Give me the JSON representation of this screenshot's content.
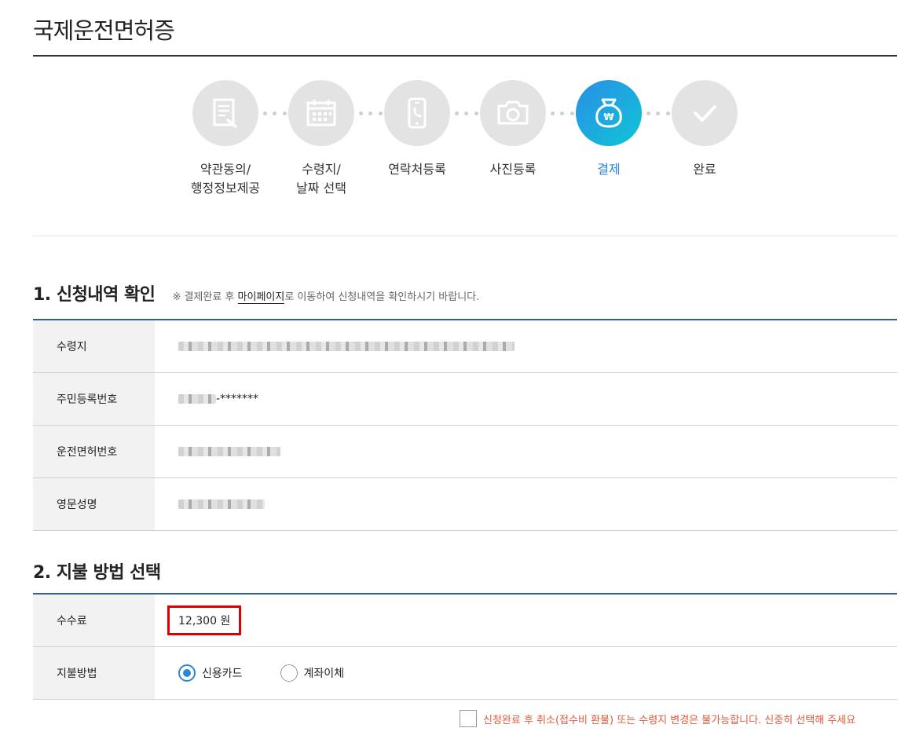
{
  "page": {
    "title": "국제운전면허증"
  },
  "steps": [
    {
      "label": "약관동의/\n행정정보제공",
      "icon": "document-edit-icon",
      "active": false
    },
    {
      "label": "수령지/\n날짜 선택",
      "icon": "calendar-icon",
      "active": false
    },
    {
      "label": "연락처등록",
      "icon": "phone-icon",
      "active": false
    },
    {
      "label": "사진등록",
      "icon": "camera-icon",
      "active": false
    },
    {
      "label": "결제",
      "icon": "money-bag-won-icon",
      "active": true
    },
    {
      "label": "완료",
      "icon": "check-icon",
      "active": false
    }
  ],
  "section1": {
    "title": "1. 신청내역 확인",
    "note_prefix": "※ 결제완료 후 ",
    "note_link": "마이페이지",
    "note_suffix": "로 이동하여 신청내역을 확인하시기 바랍니다.",
    "rows": [
      {
        "label": "수령지",
        "value": ""
      },
      {
        "label": "주민등록번호",
        "value": "-*******"
      },
      {
        "label": "운전면허번호",
        "value": ""
      },
      {
        "label": "영문성명",
        "value": ""
      }
    ]
  },
  "section2": {
    "title": "2. 지불 방법 선택",
    "fee_label": "수수료",
    "fee_value": "12,300 원",
    "method_label": "지불방법",
    "methods": [
      {
        "label": "신용카드",
        "checked": true
      },
      {
        "label": "계좌이체",
        "checked": false
      }
    ]
  },
  "agreement": {
    "text": "신청완료 후 취소(접수비 환불) 또는 수령지 변경은 불가능합니다. 신중히 선택해 주세요",
    "checked": false
  },
  "colors": {
    "accent": "#2a86d8",
    "table_border": "#2f5f93",
    "warning": "#e05a3a",
    "highlight": "#e00000"
  }
}
